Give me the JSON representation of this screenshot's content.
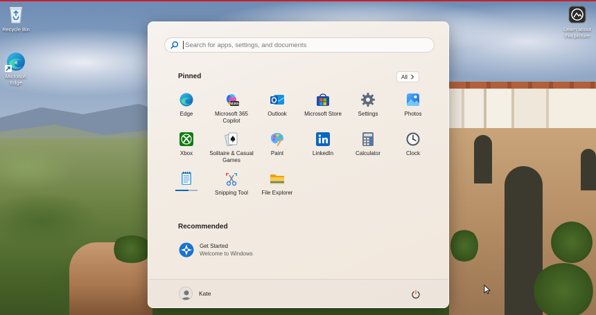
{
  "desktop": {
    "icons": [
      {
        "label": "Recycle Bin"
      },
      {
        "label": "Microsoft Edge"
      },
      {
        "label": "Learn about this picture"
      }
    ]
  },
  "start_menu": {
    "search": {
      "placeholder": "Search for apps, settings, and documents",
      "value": ""
    },
    "pinned": {
      "title": "Pinned",
      "all_button": "All",
      "apps": [
        {
          "label": "Edge",
          "icon": "edge-icon"
        },
        {
          "label": "Microsoft 365 Copilot",
          "icon": "m365-copilot-icon"
        },
        {
          "label": "Outlook",
          "icon": "outlook-icon"
        },
        {
          "label": "Microsoft Store",
          "icon": "store-icon"
        },
        {
          "label": "Settings",
          "icon": "gear-icon"
        },
        {
          "label": "Photos",
          "icon": "photos-icon"
        },
        {
          "label": "Xbox",
          "icon": "xbox-icon"
        },
        {
          "label": "Solitaire & Casual Games",
          "icon": "solitaire-icon"
        },
        {
          "label": "Paint",
          "icon": "paint-icon"
        },
        {
          "label": "LinkedIn",
          "icon": "linkedin-icon"
        },
        {
          "label": "Calculator",
          "icon": "calculator-icon"
        },
        {
          "label": "Clock",
          "icon": "clock-icon"
        },
        {
          "label": "",
          "icon": "notepad-icon"
        },
        {
          "label": "Snipping Tool",
          "icon": "snipping-tool-icon"
        },
        {
          "label": "File Explorer",
          "icon": "folder-icon"
        }
      ]
    },
    "recommended": {
      "title": "Recommended",
      "items": [
        {
          "title": "Get Started",
          "subtitle": "Welcome to Windows",
          "icon": "get-started-icon"
        }
      ]
    },
    "footer": {
      "user_name": "Kate",
      "power_icon": "power-icon"
    }
  },
  "colors": {
    "accent": "#0067c0",
    "top_line": "#c8202a"
  }
}
